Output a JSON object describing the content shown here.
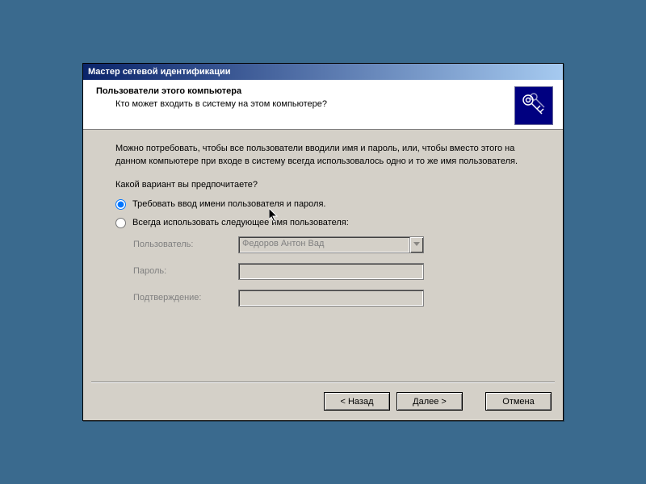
{
  "window": {
    "title": "Мастер сетевой идентификации"
  },
  "header": {
    "title": "Пользователи этого компьютера",
    "subtitle": "Кто может входить в систему на этом компьютере?"
  },
  "body": {
    "paragraph": "Можно потребовать, чтобы все пользователи вводили имя и пароль, или, чтобы вместо этого на данном компьютере при входе в систему всегда использовалось одно и то же имя пользователя.",
    "question": "Какой вариант вы предпочитаете?",
    "radio1": "Требовать ввод имени пользователя и пароля.",
    "radio2": "Всегда использовать следующее имя пользователя:",
    "selected_radio": 1
  },
  "fields": {
    "user_label": "Пользователь:",
    "user_value": "Федоров Антон Вад",
    "password_label": "Пароль:",
    "password_value": "",
    "confirm_label": "Подтверждение:",
    "confirm_value": ""
  },
  "buttons": {
    "back": "< Назад",
    "next": "Далее >",
    "cancel": "Отмена"
  },
  "colors": {
    "desktop": "#3a6a8e",
    "dialog_face": "#d4d0c8",
    "titlebar_start": "#0a246a",
    "titlebar_end": "#a6caf0",
    "icon_bg": "#000080"
  }
}
